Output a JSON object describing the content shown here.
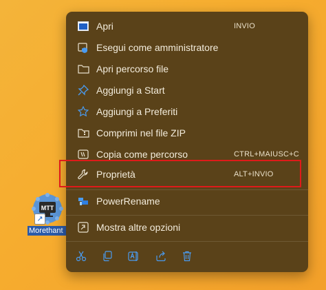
{
  "desktop": {
    "shortcut_label": "Morethant",
    "icon_badge_text": "MTT"
  },
  "menu": {
    "items": [
      {
        "label": "Apri",
        "shortcut": "INVIO",
        "icon": "app-window-icon"
      },
      {
        "label": "Esegui come amministratore",
        "shortcut": "",
        "icon": "shield-admin-icon"
      },
      {
        "label": "Apri percorso file",
        "shortcut": "",
        "icon": "folder-icon"
      },
      {
        "label": "Aggiungi a Start",
        "shortcut": "",
        "icon": "pin-icon"
      },
      {
        "label": "Aggiungi a Preferiti",
        "shortcut": "",
        "icon": "star-icon"
      },
      {
        "label": "Comprimi nel file ZIP",
        "shortcut": "",
        "icon": "zip-folder-icon"
      },
      {
        "label": "Copia come percorso",
        "shortcut": "CTRL+MAIUSC+C",
        "icon": "copy-path-icon"
      },
      {
        "label": "Proprietà",
        "shortcut": "ALT+INVIO",
        "icon": "wrench-icon"
      },
      {
        "label": "PowerRename",
        "shortcut": "",
        "icon": "powerrename-icon"
      },
      {
        "label": "Mostra altre opzioni",
        "shortcut": "",
        "icon": "expand-icon"
      }
    ],
    "bottom_actions": [
      "cut-icon",
      "copy-icon",
      "rename-icon",
      "share-icon",
      "delete-icon"
    ]
  },
  "colors": {
    "menu_bg": "#5a4219",
    "highlight_border": "#e01a1a",
    "accent_blue": "#4a9bf0",
    "desktop_bg": "#f4b43a"
  }
}
